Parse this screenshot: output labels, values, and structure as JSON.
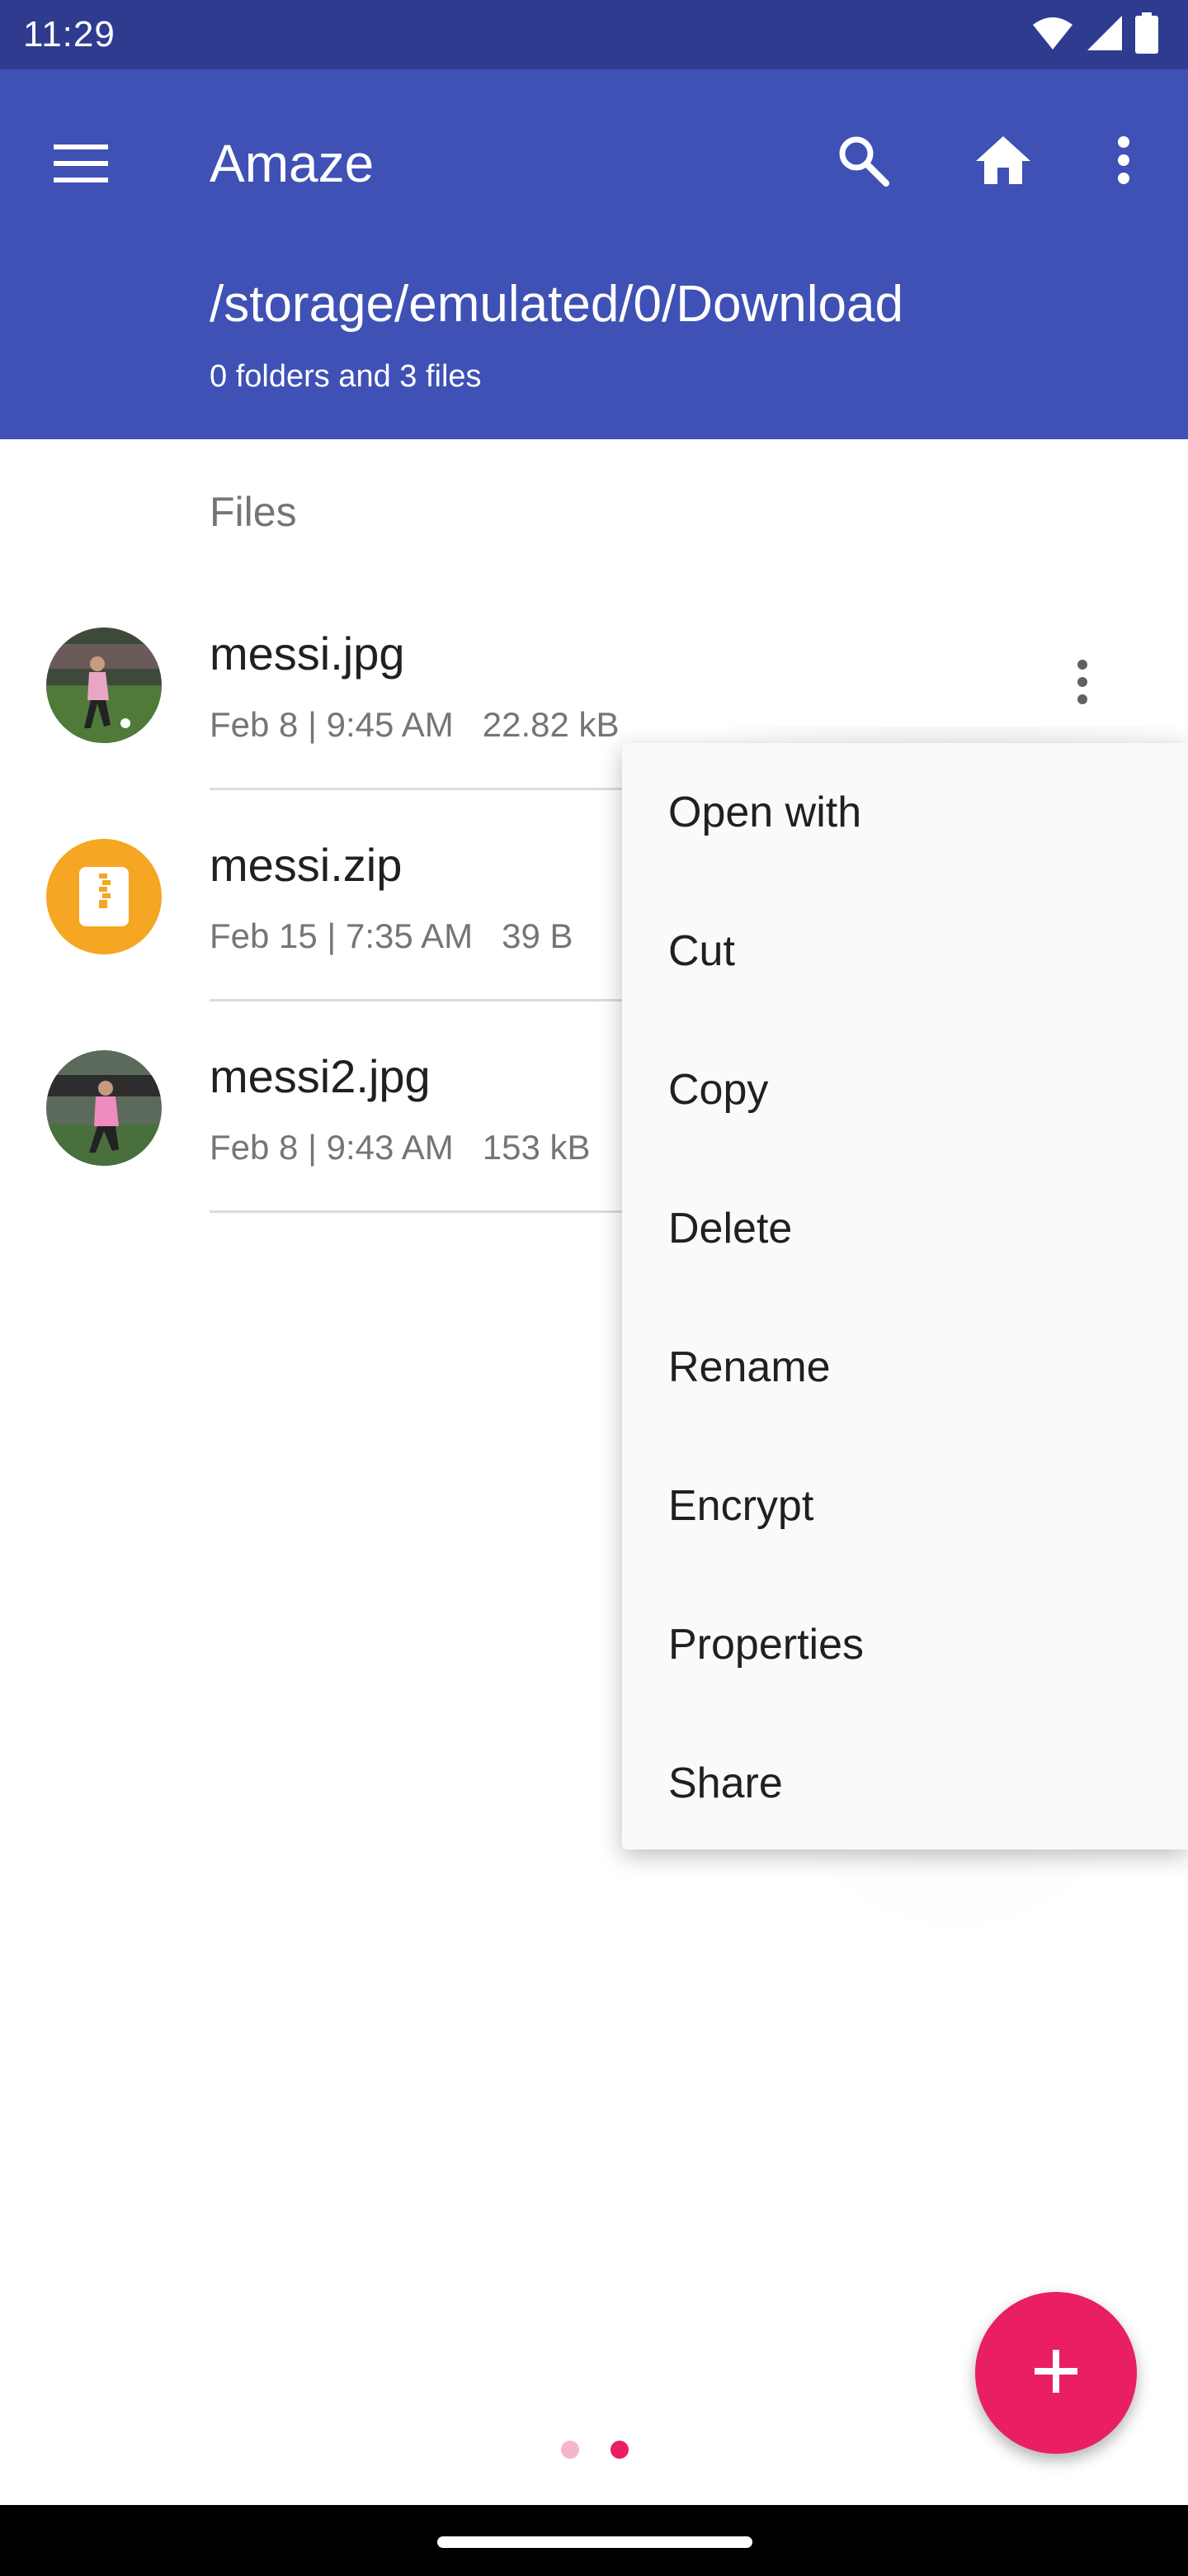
{
  "status_bar": {
    "time": "11:29",
    "icons": [
      "wifi-icon",
      "signal-icon",
      "battery-icon"
    ]
  },
  "app_bar": {
    "title": "Amaze",
    "path": "/storage/emulated/0/Download",
    "summary": "0 folders and 3 files",
    "color": "#3f51b5"
  },
  "list": {
    "section_header": "Files",
    "files": [
      {
        "name": "messi.jpg",
        "meta": "Feb 8 | 9:45 AM   22.82 kB",
        "icon": "image-thumbnail"
      },
      {
        "name": "messi.zip",
        "meta": "Feb 15 | 7:35 AM   39 B",
        "icon": "zip-icon"
      },
      {
        "name": "messi2.jpg",
        "meta": "Feb 8 | 9:43 AM   153 kB",
        "icon": "image-thumbnail"
      }
    ]
  },
  "popup_menu": {
    "items": [
      "Open with",
      "Cut",
      "Copy",
      "Delete",
      "Rename",
      "Encrypt",
      "Properties",
      "Share"
    ]
  },
  "fab": {
    "icon": "plus-icon",
    "color": "#e91e63"
  },
  "page_indicator": {
    "count": 2,
    "active_index": 1
  }
}
